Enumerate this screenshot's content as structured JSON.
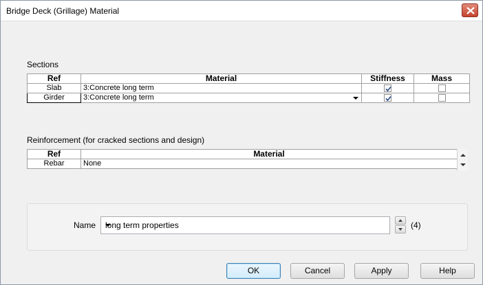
{
  "window": {
    "title": "Bridge Deck (Grillage) Material"
  },
  "sections": {
    "label": "Sections",
    "columns": [
      "Ref",
      "Material",
      "Stiffness",
      "Mass"
    ],
    "rows": [
      {
        "ref": "Slab",
        "material": "3:Concrete long term",
        "stiffness": true,
        "mass": false
      },
      {
        "ref": "Girder",
        "material": "3:Concrete long term",
        "stiffness": true,
        "mass": false
      }
    ]
  },
  "reinforcement": {
    "label": "Reinforcement (for cracked sections and design)",
    "columns": [
      "Ref",
      "Material"
    ],
    "rows": [
      {
        "ref": "Rebar",
        "material": "None"
      }
    ]
  },
  "name_field": {
    "label": "Name",
    "value": "long term properties",
    "count": "(4)"
  },
  "buttons": {
    "ok": "OK",
    "cancel": "Cancel",
    "apply": "Apply",
    "help": "Help"
  }
}
